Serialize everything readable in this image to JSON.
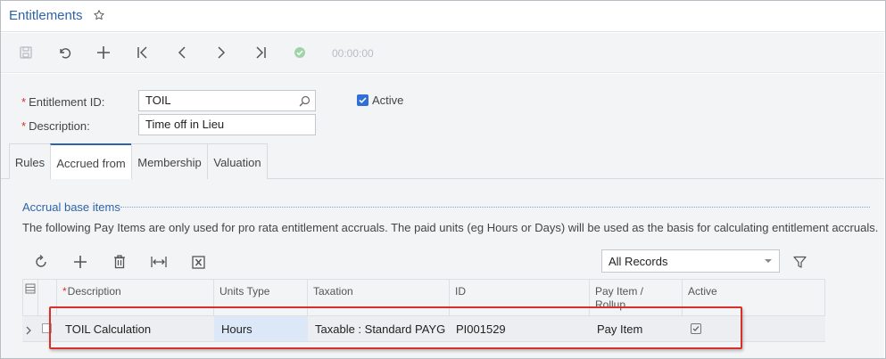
{
  "screen": {
    "title": "Entitlements",
    "icons": {
      "favorite": "star-outline-icon"
    }
  },
  "toolbar": {
    "icons": [
      "save-icon",
      "undo-icon",
      "add-icon",
      "first-record-icon",
      "previous-record-icon",
      "next-record-icon",
      "last-record-icon",
      "check-circle-icon"
    ],
    "timer": "00:00:00"
  },
  "form": {
    "entitlement_id": {
      "label": "Entitlement ID:",
      "value": "TOIL",
      "required_mark": "*"
    },
    "description": {
      "label": "Description:",
      "value": "Time off in Lieu",
      "required_mark": "*"
    },
    "active": {
      "label": "Active",
      "checked": true
    }
  },
  "tabs": [
    {
      "label": "Rules",
      "active": false
    },
    {
      "label": "Accrued from",
      "active": true
    },
    {
      "label": "Membership",
      "active": false
    },
    {
      "label": "Valuation",
      "active": false
    }
  ],
  "section": {
    "title": "Accrual base items",
    "description": "The following Pay Items are only used for pro rata entitlement accruals. The paid units (eg Hours or Days) will be used as the basis for calculating entitlement accruals."
  },
  "grid_toolbar": {
    "icons": [
      "refresh-icon",
      "add-row-icon",
      "delete-icon",
      "fit-columns-icon",
      "export-excel-icon",
      "filter-icon"
    ],
    "filter_select": "All Records"
  },
  "grid": {
    "columns": [
      "Description",
      "Units Type",
      "Taxation",
      "ID",
      "Pay Item / Rollup",
      "Active"
    ],
    "required_mark": "*",
    "rows": [
      {
        "description": "TOIL Calculation",
        "units_type": "Hours",
        "taxation": "Taxable : Standard PAYG",
        "id": "PI001529",
        "pay_item_rollup": "Pay Item",
        "active": true
      }
    ]
  },
  "colors": {
    "accent": "#2d63a8",
    "highlight_border": "#d9302c",
    "checkbox": "#2f6fd6"
  }
}
